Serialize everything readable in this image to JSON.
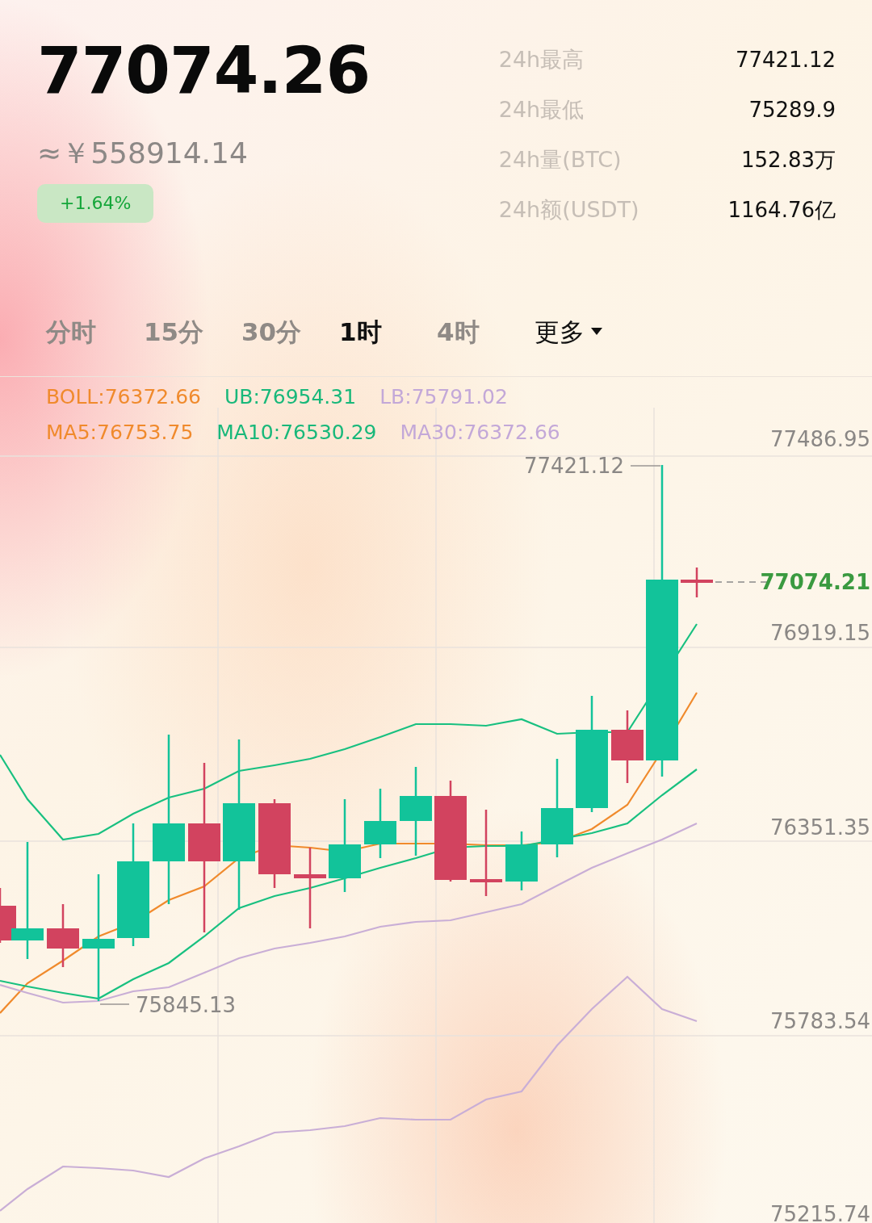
{
  "price": "77074.26",
  "cny_price": "≈￥558914.14",
  "change": {
    "text": "+1.64%",
    "rising": true
  },
  "stats": [
    {
      "label": "24h最高",
      "value": "77421.12"
    },
    {
      "label": "24h最低",
      "value": "75289.9"
    },
    {
      "label": "24h量(BTC)",
      "value": "152.83万"
    },
    {
      "label": "24h额(USDT)",
      "value": "1164.76亿"
    }
  ],
  "tabs": [
    {
      "label": "分时",
      "selected": false,
      "kind": "interval"
    },
    {
      "label": "15分",
      "selected": false,
      "kind": "interval"
    },
    {
      "label": "30分",
      "selected": false,
      "kind": "interval"
    },
    {
      "label": "1时",
      "selected": true,
      "kind": "interval"
    },
    {
      "label": "4时",
      "selected": false,
      "kind": "interval"
    },
    {
      "label": "更多",
      "selected": false,
      "kind": "dropdown"
    }
  ],
  "indicators": [
    [
      {
        "label": "BOLL:76372.66",
        "color": "#f08a2c"
      },
      {
        "label": "UB:76954.31",
        "color": "#18b87a"
      },
      {
        "label": "LB:75791.02",
        "color": "#c3a8d8"
      }
    ],
    [
      {
        "label": "MA5:76753.75",
        "color": "#f08a2c"
      },
      {
        "label": "MA10:76530.29",
        "color": "#18b87a"
      },
      {
        "label": "MA30:76372.66",
        "color": "#c3a8d8"
      }
    ]
  ],
  "chart": {
    "price_axis": [
      "77486.95",
      "76919.15",
      "76351.35",
      "75783.54",
      "75215.74"
    ],
    "high_label": "77421.12",
    "low_label": "75845.13",
    "last_price": "77074.21"
  }
}
